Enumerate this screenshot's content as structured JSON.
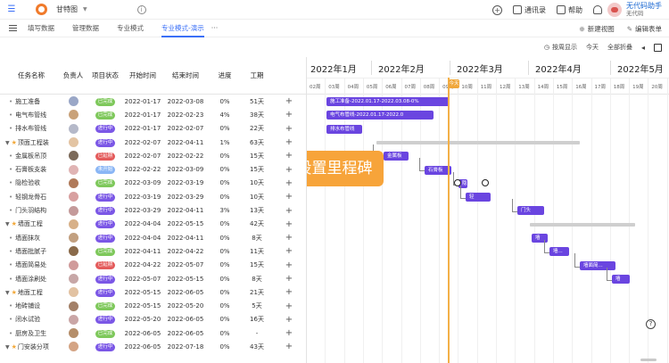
{
  "header": {
    "title": "甘特图",
    "right_buttons": [
      {
        "label": "",
        "icon": "add-circle-icon"
      },
      {
        "label": "通讯录",
        "icon": "contacts-icon"
      },
      {
        "label": "帮助",
        "icon": "help-icon"
      },
      {
        "label": "",
        "icon": "bell-icon"
      }
    ],
    "user_name": "无代码助手",
    "user_org": "无代码"
  },
  "tabs": [
    {
      "label": "填写数据",
      "active": false
    },
    {
      "label": "管理数据",
      "active": false
    },
    {
      "label": "专业模式",
      "active": false
    },
    {
      "label": "专业模式-演示",
      "active": true
    }
  ],
  "tab_actions": {
    "new_view": "新建视图",
    "edit_form": "编辑表单"
  },
  "toolbar": {
    "by_week": "按周显示",
    "today": "今天",
    "collapse_all": "全部折叠"
  },
  "columns": [
    "任务名称",
    "负责人",
    "项目状态",
    "开始时间",
    "结束时间",
    "进度",
    "工期"
  ],
  "colors": {
    "done": "#7ec85b",
    "in_progress": "#7b57e6",
    "not_started": "#e45b5b",
    "pending": "#8ab6f5",
    "bar": "#6a45e0",
    "accent": "#3a6ff7"
  },
  "rows": [
    {
      "name": "施工准备",
      "level": 1,
      "status": "已完成",
      "status_color": "#7ec85b",
      "avatar": "#9aa7c7",
      "start": "2022-01-17",
      "end": "2022-03-08",
      "progress": "0%",
      "duration": "51天"
    },
    {
      "name": "电气布管线",
      "level": 1,
      "status": "已完成",
      "status_color": "#7ec85b",
      "avatar": "#c9a27a",
      "start": "2022-01-17",
      "end": "2022-02-23",
      "progress": "4%",
      "duration": "38天"
    },
    {
      "name": "排水布管线",
      "level": 1,
      "status": "进行中",
      "status_color": "#7b57e6",
      "avatar": "#b5b9c9",
      "start": "2022-01-17",
      "end": "2022-02-07",
      "progress": "0%",
      "duration": "22天"
    },
    {
      "name": "顶面工程装",
      "level": 0,
      "status": "进行中",
      "status_color": "#7b57e6",
      "avatar": "#e3c4a3",
      "start": "2022-02-07",
      "end": "2022-04-11",
      "progress": "1%",
      "duration": "63天"
    },
    {
      "name": "金属板吊顶",
      "level": 1,
      "status": "已延期",
      "status_color": "#e45b5b",
      "avatar": "#7c6a5a",
      "start": "2022-02-07",
      "end": "2022-02-22",
      "progress": "0%",
      "duration": "15天"
    },
    {
      "name": "石膏板支装",
      "level": 1,
      "status": "未开始",
      "status_color": "#8ab6f5",
      "avatar": "#e0b4b4",
      "start": "2022-02-22",
      "end": "2022-03-09",
      "progress": "0%",
      "duration": "15天"
    },
    {
      "name": "隐检验收",
      "level": 1,
      "status": "已完成",
      "status_color": "#7ec85b",
      "avatar": "#b07a5a",
      "start": "2022-03-09",
      "end": "2022-03-19",
      "progress": "0%",
      "duration": "10天"
    },
    {
      "name": "轻钢龙骨石",
      "level": 1,
      "status": "进行中",
      "status_color": "#7b57e6",
      "avatar": "#d8a0a0",
      "start": "2022-03-19",
      "end": "2022-03-29",
      "progress": "0%",
      "duration": "10天"
    },
    {
      "name": "门头羽结构",
      "level": 1,
      "status": "进行中",
      "status_color": "#7b57e6",
      "avatar": "#c49a9a",
      "start": "2022-03-29",
      "end": "2022-04-11",
      "progress": "3%",
      "duration": "13天"
    },
    {
      "name": "墙面工程",
      "level": 0,
      "status": "进行中",
      "status_color": "#7b57e6",
      "avatar": "#d7b088",
      "start": "2022-04-04",
      "end": "2022-05-15",
      "progress": "0%",
      "duration": "42天"
    },
    {
      "name": "墙面抹灰",
      "level": 1,
      "status": "进行中",
      "status_color": "#7b57e6",
      "avatar": "#c2a080",
      "start": "2022-04-04",
      "end": "2022-04-11",
      "progress": "0%",
      "duration": "8天"
    },
    {
      "name": "墙面批腻子",
      "level": 1,
      "status": "已完成",
      "status_color": "#7ec85b",
      "avatar": "#8a6a4a",
      "start": "2022-04-11",
      "end": "2022-04-22",
      "progress": "0%",
      "duration": "11天"
    },
    {
      "name": "墙面简易处",
      "level": 1,
      "status": "已延期",
      "status_color": "#e45b5b",
      "avatar": "#d09b9b",
      "start": "2022-04-22",
      "end": "2022-05-07",
      "progress": "0%",
      "duration": "15天"
    },
    {
      "name": "墙面涂刷处",
      "level": 1,
      "status": "进行中",
      "status_color": "#7b57e6",
      "avatar": "#c7a7a7",
      "start": "2022-05-07",
      "end": "2022-05-15",
      "progress": "0%",
      "duration": "8天"
    },
    {
      "name": "地面工程",
      "level": 0,
      "status": "进行中",
      "status_color": "#7b57e6",
      "avatar": "#e2c2a2",
      "start": "2022-05-15",
      "end": "2022-06-05",
      "progress": "0%",
      "duration": "21天"
    },
    {
      "name": "地砖铺设",
      "level": 1,
      "status": "已完成",
      "status_color": "#7ec85b",
      "avatar": "#a38068",
      "start": "2022-05-15",
      "end": "2022-05-20",
      "progress": "0%",
      "duration": "5天"
    },
    {
      "name": "闭水试验",
      "level": 1,
      "status": "进行中",
      "status_color": "#7b57e6",
      "avatar": "#caa6a6",
      "start": "2022-05-20",
      "end": "2022-06-05",
      "progress": "0%",
      "duration": "16天"
    },
    {
      "name": "厨房及卫生",
      "level": 1,
      "status": "已完成",
      "status_color": "#7ec85b",
      "avatar": "#b58e6a",
      "start": "2022-06-05",
      "end": "2022-06-05",
      "progress": "0%",
      "duration": "-"
    },
    {
      "name": "门安装分项",
      "level": 0,
      "status": "进行中",
      "status_color": "#7b57e6",
      "avatar": "#d4a484",
      "start": "2022-06-05",
      "end": "2022-07-18",
      "progress": "0%",
      "duration": "43天"
    }
  ],
  "gantt": {
    "months": [
      "2022年1月",
      "2022年2月",
      "2022年3月",
      "2022年4月",
      "2022年5月"
    ],
    "days": [
      "02周",
      "03周",
      "04周",
      "05周",
      "06周",
      "07周",
      "08周",
      "09周",
      "10周",
      "11周",
      "12周",
      "13周",
      "14周",
      "15周",
      "16周",
      "17周",
      "18周",
      "19周",
      "20周"
    ],
    "bar_labels": [
      "施工准备-2022.01.17-2022.03.08-0%",
      "电气布管线-2022.01.17-2022.0",
      "排水布管线",
      "",
      "金属板",
      "石膏板",
      "隐",
      "轻",
      "门头",
      "",
      "墙",
      "墙...",
      "墙面简...",
      "墙"
    ],
    "today_label": "今天",
    "tooltip": "设置里程碑"
  }
}
